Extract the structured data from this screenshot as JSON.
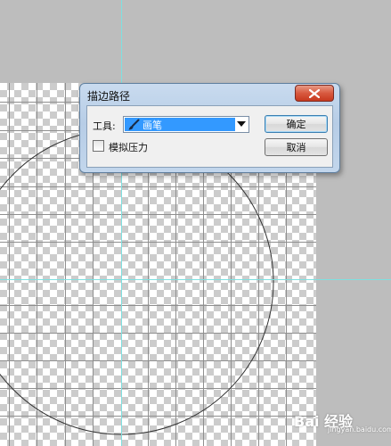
{
  "dialog": {
    "title": "描边路径",
    "tool_label": "工具:",
    "tool_value": "画笔",
    "checkbox_label": "模拟压力",
    "checkbox_checked": false,
    "ok_label": "确定",
    "cancel_label": "取消"
  },
  "icons": {
    "close": "close-icon",
    "brush": "brush-icon",
    "dropdown": "chevron-down-icon"
  },
  "colors": {
    "selection": "#3399ff",
    "guide": "#7fe0e0",
    "close_button": "#d8593f"
  },
  "watermark": {
    "text": "Bai 经验",
    "url": "jingyan.baidu.com"
  }
}
